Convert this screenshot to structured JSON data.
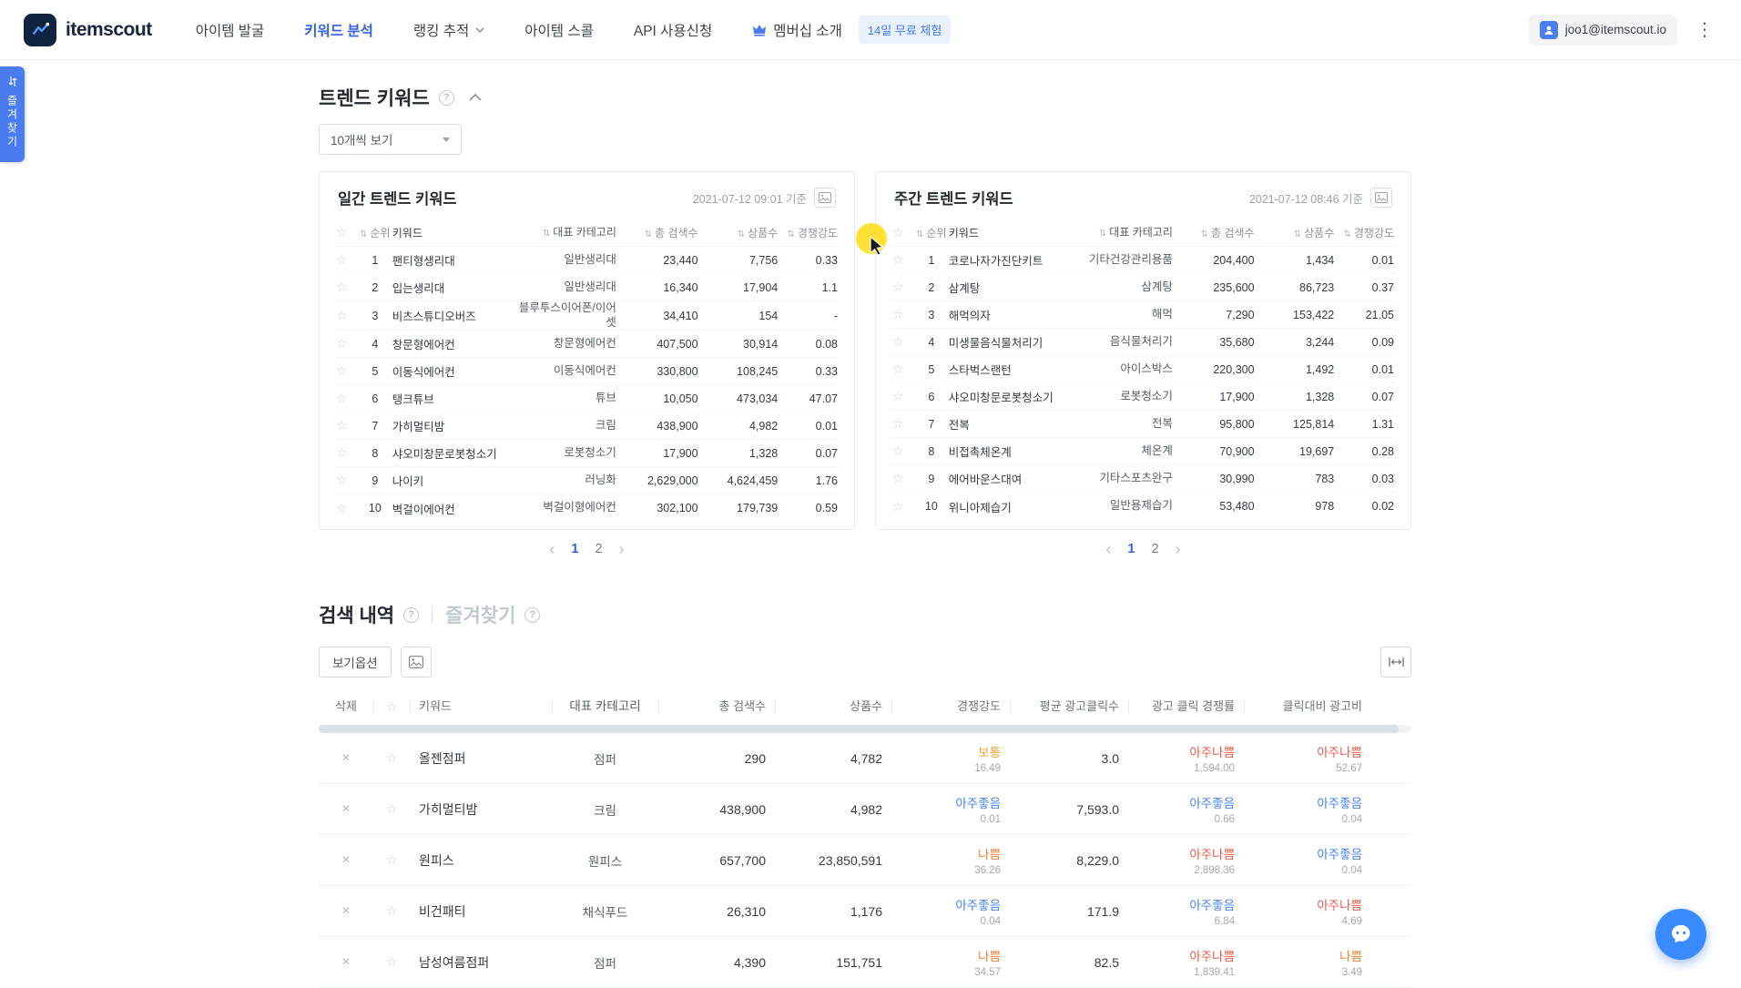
{
  "header": {
    "logo_text": "itemscout",
    "nav": {
      "item_discovery": "아이템 발굴",
      "keyword_analysis": "키워드 분석",
      "ranking_tracker": "랭킹 추적",
      "item_school": "아이템 스콜",
      "api_request": "API 사용신청",
      "membership": "멤버십 소개"
    },
    "trial_badge": "14일 무료 체험",
    "account_email": "joo1@itemscout.io"
  },
  "favorites_tab_label": "즐겨찾기",
  "trend": {
    "title": "트렌드 키워드",
    "page_size": "10개씩 보기",
    "columns": {
      "rank": "순위",
      "keyword": "키워드",
      "category": "대표 카테고리",
      "search": "총 검색수",
      "products": "상품수",
      "competition": "경쟁강도"
    },
    "daily": {
      "title": "일간 트렌드 키워드",
      "timestamp": "2021-07-12 09:01 기준",
      "rows": [
        {
          "rank": "1",
          "keyword": "팬티형생리대",
          "category": "일반생리대",
          "search": "23,440",
          "products": "7,756",
          "competition": "0.33"
        },
        {
          "rank": "2",
          "keyword": "입는생리대",
          "category": "일반생리대",
          "search": "16,340",
          "products": "17,904",
          "competition": "1.1"
        },
        {
          "rank": "3",
          "keyword": "비츠스튜디오버즈",
          "category": "블루투스이어폰/이어셋",
          "search": "34,410",
          "products": "154",
          "competition": "-"
        },
        {
          "rank": "4",
          "keyword": "창문형에어컨",
          "category": "창문형에어컨",
          "search": "407,500",
          "products": "30,914",
          "competition": "0.08"
        },
        {
          "rank": "5",
          "keyword": "이동식에어컨",
          "category": "이동식에어컨",
          "search": "330,800",
          "products": "108,245",
          "competition": "0.33"
        },
        {
          "rank": "6",
          "keyword": "탱크튜브",
          "category": "튜브",
          "search": "10,050",
          "products": "473,034",
          "competition": "47.07"
        },
        {
          "rank": "7",
          "keyword": "가히멀티밤",
          "category": "크림",
          "search": "438,900",
          "products": "4,982",
          "competition": "0.01"
        },
        {
          "rank": "8",
          "keyword": "샤오미창문로봇청소기",
          "category": "로봇청소기",
          "search": "17,900",
          "products": "1,328",
          "competition": "0.07"
        },
        {
          "rank": "9",
          "keyword": "나이키",
          "category": "러닝화",
          "search": "2,629,000",
          "products": "4,624,459",
          "competition": "1.76"
        },
        {
          "rank": "10",
          "keyword": "벽걸이에어컨",
          "category": "벽걸이형에어컨",
          "search": "302,100",
          "products": "179,739",
          "competition": "0.59"
        }
      ]
    },
    "weekly": {
      "title": "주간 트렌드 키워드",
      "timestamp": "2021-07-12 08:46 기준",
      "rows": [
        {
          "rank": "1",
          "keyword": "코로나자가진단키트",
          "category": "기타건강관리용품",
          "search": "204,400",
          "products": "1,434",
          "competition": "0.01"
        },
        {
          "rank": "2",
          "keyword": "삼계탕",
          "category": "삼계탕",
          "search": "235,600",
          "products": "86,723",
          "competition": "0.37"
        },
        {
          "rank": "3",
          "keyword": "해먹의자",
          "category": "해먹",
          "search": "7,290",
          "products": "153,422",
          "competition": "21.05"
        },
        {
          "rank": "4",
          "keyword": "미생물음식물처리기",
          "category": "음식물처리기",
          "search": "35,680",
          "products": "3,244",
          "competition": "0.09"
        },
        {
          "rank": "5",
          "keyword": "스타벅스랜턴",
          "category": "아이스박스",
          "search": "220,300",
          "products": "1,492",
          "competition": "0.01"
        },
        {
          "rank": "6",
          "keyword": "샤오미창문로봇청소기",
          "category": "로봇청소기",
          "search": "17,900",
          "products": "1,328",
          "competition": "0.07"
        },
        {
          "rank": "7",
          "keyword": "전복",
          "category": "전복",
          "search": "95,800",
          "products": "125,814",
          "competition": "1.31"
        },
        {
          "rank": "8",
          "keyword": "비접촉체온계",
          "category": "체온계",
          "search": "70,900",
          "products": "19,697",
          "competition": "0.28"
        },
        {
          "rank": "9",
          "keyword": "에어바운스대여",
          "category": "기타스포츠완구",
          "search": "30,990",
          "products": "783",
          "competition": "0.03"
        },
        {
          "rank": "10",
          "keyword": "위니아제습기",
          "category": "일반용제습기",
          "search": "53,480",
          "products": "978",
          "competition": "0.02"
        }
      ]
    },
    "pagination": {
      "page1": "1",
      "page2": "2"
    }
  },
  "history": {
    "title": "검색 내역",
    "favorites_title": "즐겨찾기",
    "view_options": "보기옵션",
    "columns": {
      "delete": "삭제",
      "keyword": "키워드",
      "category": "대표 카테고리",
      "search": "총 검색수",
      "products": "상품수",
      "competition": "경쟁강도",
      "avg_clicks": "평균 광고클릭수",
      "click_ratio": "광고 클릭 경쟁률",
      "cost_ratio": "클릭대비 광고비"
    },
    "rows": [
      {
        "keyword": "올젠점퍼",
        "category": "점퍼",
        "search": "290",
        "products": "4,782",
        "competition": {
          "grade": "보통",
          "value": "16.49"
        },
        "avg_clicks": "3.0",
        "click_ratio": {
          "grade": "아주나쁨",
          "value": "1,594.00"
        },
        "cost_ratio": {
          "grade": "아주나쁨",
          "value": "52.67"
        }
      },
      {
        "keyword": "가히멀티밤",
        "category": "크림",
        "search": "438,900",
        "products": "4,982",
        "competition": {
          "grade": "아주좋음",
          "value": "0.01"
        },
        "avg_clicks": "7,593.0",
        "click_ratio": {
          "grade": "아주좋음",
          "value": "0.66"
        },
        "cost_ratio": {
          "grade": "아주좋음",
          "value": "0.04"
        }
      },
      {
        "keyword": "원피스",
        "category": "원피스",
        "search": "657,700",
        "products": "23,850,591",
        "competition": {
          "grade": "나쁨",
          "value": "36.26"
        },
        "avg_clicks": "8,229.0",
        "click_ratio": {
          "grade": "아주나쁨",
          "value": "2,898.36"
        },
        "cost_ratio": {
          "grade": "아주좋음",
          "value": "0.04"
        }
      },
      {
        "keyword": "비건패티",
        "category": "채식푸드",
        "search": "26,310",
        "products": "1,176",
        "competition": {
          "grade": "아주좋음",
          "value": "0.04"
        },
        "avg_clicks": "171.9",
        "click_ratio": {
          "grade": "아주좋음",
          "value": "6.84"
        },
        "cost_ratio": {
          "grade": "아주나쁨",
          "value": "4.69"
        }
      },
      {
        "keyword": "남성여름점퍼",
        "category": "점퍼",
        "search": "4,390",
        "products": "151,751",
        "competition": {
          "grade": "나쁨",
          "value": "34.57"
        },
        "avg_clicks": "82.5",
        "click_ratio": {
          "grade": "아주나쁨",
          "value": "1,839.41"
        },
        "cost_ratio": {
          "grade": "나쁨",
          "value": "3.49"
        }
      }
    ]
  },
  "colors": {
    "brand_blue": "#3061e3",
    "grade_verygood": "#4583f2",
    "grade_normal": "#f0a63e",
    "grade_bad": "#ef8136",
    "grade_verybad": "#e85c4a"
  }
}
